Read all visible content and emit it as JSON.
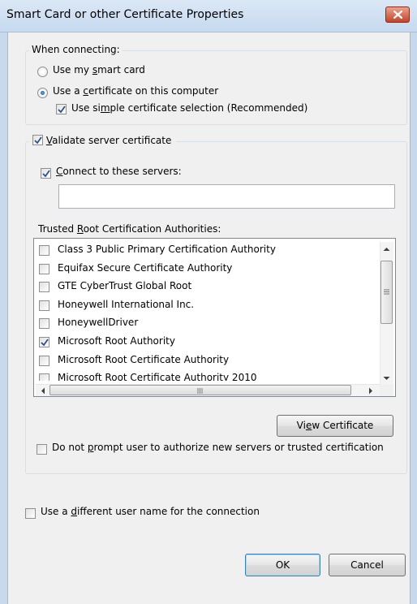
{
  "window": {
    "title": "Smart Card or other Certificate Properties"
  },
  "connecting": {
    "legend": "When connecting:",
    "use_smart_card_pre": "Use my ",
    "use_smart_card_u": "s",
    "use_smart_card_post": "mart card",
    "use_cert_pre": "Use a ",
    "use_cert_u": "c",
    "use_cert_post": "ertificate on this computer",
    "simple_pre": "Use si",
    "simple_u": "m",
    "simple_post": "ple certificate selection (Recommended)",
    "selected_option": "use_certificate",
    "simple_selection_checked": true
  },
  "validate": {
    "legend_u": "V",
    "legend_post": "alidate server certificate",
    "checked": true,
    "connect_u": "C",
    "connect_post": "onnect to these servers:",
    "connect_checked": true,
    "servers_value": "",
    "trusted_pre": "Trusted ",
    "trusted_u": "R",
    "trusted_post": "oot Certification Authorities:",
    "authorities": [
      {
        "label": "Class 3 Public Primary Certification Authority",
        "checked": false
      },
      {
        "label": "Equifax Secure Certificate Authority",
        "checked": false
      },
      {
        "label": "GTE CyberTrust Global Root",
        "checked": false
      },
      {
        "label": "Honeywell International Inc.",
        "checked": false
      },
      {
        "label": "HoneywellDriver",
        "checked": false
      },
      {
        "label": "Microsoft Root Authority",
        "checked": true
      },
      {
        "label": "Microsoft Root Certificate Authority",
        "checked": false
      },
      {
        "label": "Microsoft Root Certificate Authority 2010",
        "checked": false
      }
    ],
    "view_cert_pre": "Vi",
    "view_cert_u": "e",
    "view_cert_post": "w Certificate",
    "no_prompt_pre": "Do not ",
    "no_prompt_u": "p",
    "no_prompt_post": "rompt user to authorize new servers or trusted certification",
    "no_prompt_checked": false
  },
  "different_user": {
    "pre": "Use a ",
    "u": "d",
    "post": "ifferent user name for the connection",
    "checked": false
  },
  "buttons": {
    "ok": "OK",
    "cancel": "Cancel"
  },
  "icons": {
    "close": "close-icon",
    "check": "checkmark-icon",
    "scroll_up": "arrow-up-icon",
    "scroll_down": "arrow-down-icon",
    "scroll_left": "arrow-left-icon",
    "scroll_right": "arrow-right-icon",
    "grip": "grip-icon"
  }
}
